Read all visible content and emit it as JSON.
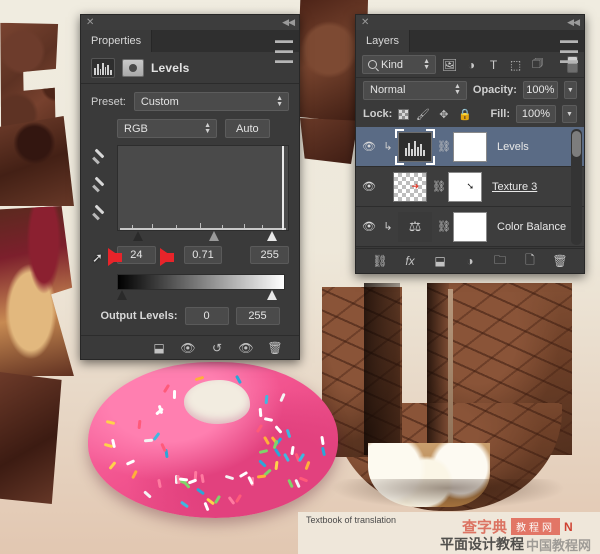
{
  "app": "Adobe Photoshop",
  "properties_panel": {
    "close_label": "✕",
    "collapse_label": "◀◀",
    "tab_label": "Properties",
    "menu_label": "≡",
    "adjustment_icon": "levels-histogram-icon",
    "mask_icon": "layer-mask-icon",
    "title": "Levels",
    "preset_label": "Preset:",
    "preset_value": "Custom",
    "channel_value": "RGB",
    "auto_label": "Auto",
    "eyedroppers": [
      "set-black-point-eyedropper",
      "set-gray-point-eyedropper",
      "set-white-point-eyedropper"
    ],
    "input_levels": {
      "shadow": "24",
      "midtone": "0.71",
      "highlight": "255"
    },
    "output_levels_label": "Output Levels:",
    "output_levels": {
      "black": "0",
      "white": "255"
    },
    "footer_buttons": [
      "clip-to-layer-button",
      "toggle-previous-state-button",
      "reset-adjustment-button",
      "toggle-visibility-button",
      "delete-adjustment-button"
    ]
  },
  "layers_panel": {
    "close_label": "✕",
    "collapse_label": "◀◀",
    "tab_label": "Layers",
    "menu_label": "≡",
    "filter_kind_label": "Kind",
    "filter_icons": [
      "filter-pixel-icon",
      "filter-adjustment-icon",
      "filter-type-icon",
      "filter-shape-icon",
      "filter-smartobject-icon"
    ],
    "blend_mode": "Normal",
    "opacity_label": "Opacity:",
    "opacity_value": "100%",
    "lock_label": "Lock:",
    "lock_icons": [
      "lock-transparent-pixels-icon",
      "lock-image-pixels-icon",
      "lock-position-icon",
      "lock-all-icon"
    ],
    "fill_label": "Fill:",
    "fill_value": "100%",
    "layers": [
      {
        "name": "Levels",
        "visible": true,
        "selected": true,
        "clipped": true,
        "linked": true,
        "thumb": "levels-adjustment-thumbnail",
        "editing": false
      },
      {
        "name": "Texture 3",
        "visible": true,
        "selected": false,
        "clipped": false,
        "linked": true,
        "thumb": "transparent-pixel-thumbnail",
        "editing": true
      },
      {
        "name": "Color Balance",
        "visible": true,
        "selected": false,
        "clipped": true,
        "linked": true,
        "thumb": "color-balance-adjustment-thumbnail",
        "editing": false
      }
    ],
    "footer_buttons": [
      "link-layers-button",
      "add-layer-style-button",
      "add-layer-mask-button",
      "new-adjustment-layer-button",
      "new-group-button",
      "new-layer-button",
      "delete-layer-button"
    ]
  },
  "annotations": {
    "arrow_color": "#e8242a",
    "arrow_count": 2,
    "cursor_icon": "mouse-cursor-icon"
  },
  "caption": {
    "text": "Textbook of translation"
  },
  "watermark": {
    "line1_cn": "查字典",
    "line1_box": "教程网",
    "line1_suffix": "N",
    "line2_cn": "平面设计教程",
    "line2_faint": "中国教程网"
  },
  "artwork": {
    "description": "chocolate-letterforms-and-pink-donut-composition",
    "donut_color": "#f2548f",
    "chocolate_color": "#6e4028",
    "background_color": "#efe9dc"
  }
}
